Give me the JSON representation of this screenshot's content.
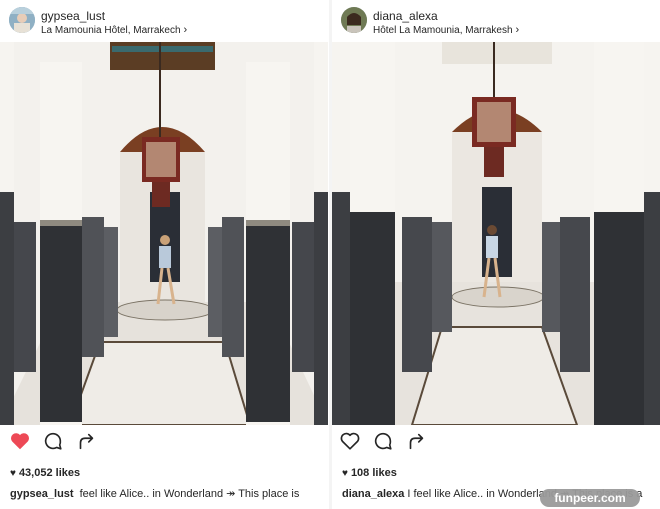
{
  "posts": [
    {
      "username": "gypsea_lust",
      "location": "La Mamounia Hôtel, Marrakech",
      "likes": "43,052 likes",
      "caption_user": "gypsea_lust",
      "caption_text": "feel like Alice.. in Wonderland ↠ This place is",
      "liked": true
    },
    {
      "username": "diana_alexa",
      "location": "Hôtel La Mamounia, Marrakesh",
      "likes": "108 likes",
      "caption_user": "diana_alexa",
      "caption_text": "I feel like Alice.. in Wonderland ↠ This place is a",
      "liked": false
    }
  ],
  "watermark": "funpeer.com",
  "colors": {
    "like_red": "#ed4956",
    "text": "#262626"
  },
  "icons": [
    "heart-icon",
    "comment-icon",
    "share-icon",
    "chevron-right-icon"
  ]
}
